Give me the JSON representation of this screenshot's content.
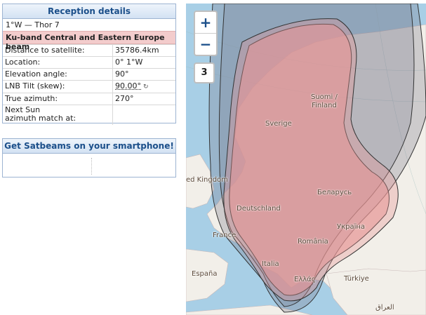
{
  "reception": {
    "title": "Reception details",
    "satellite": "1°W — Thor 7",
    "beam": "Ku-band Central and Eastern Europe beam",
    "rows": [
      {
        "label": "Distance to satellite:",
        "value": "35786.4km"
      },
      {
        "label": "Location:",
        "value": "0° 1°W"
      },
      {
        "label": "Elevation angle:",
        "value": "90°"
      },
      {
        "label": "LNB Tilt (skew):",
        "value": "90.00°"
      },
      {
        "label": "True azimuth:",
        "value": "270°"
      },
      {
        "label": "Next Sun\nazimuth match at:",
        "value": ""
      }
    ]
  },
  "smartphone": {
    "title": "Get Satbeams on your smartphone!"
  },
  "map": {
    "zoom_in": "+",
    "zoom_out": "−",
    "level": "3",
    "skew_icon": "↻",
    "labels": {
      "suomi": "Suomi /\nFinland",
      "sverige": "Sverige",
      "uk": "ed Kingdom",
      "belarus": "Беларусь",
      "deutschland": "Deutschland",
      "ukraine": "Україна",
      "france": "France",
      "romania": "România",
      "italia": "Italia",
      "espana": "España",
      "ellas": "Ελλάς",
      "turkiye": "Türkiye",
      "iraq": "العراق"
    },
    "colors": {
      "sea": "#a8cfe6",
      "land": "#f2efe9",
      "beam": "#e89a9a",
      "contour": "#333333"
    }
  }
}
